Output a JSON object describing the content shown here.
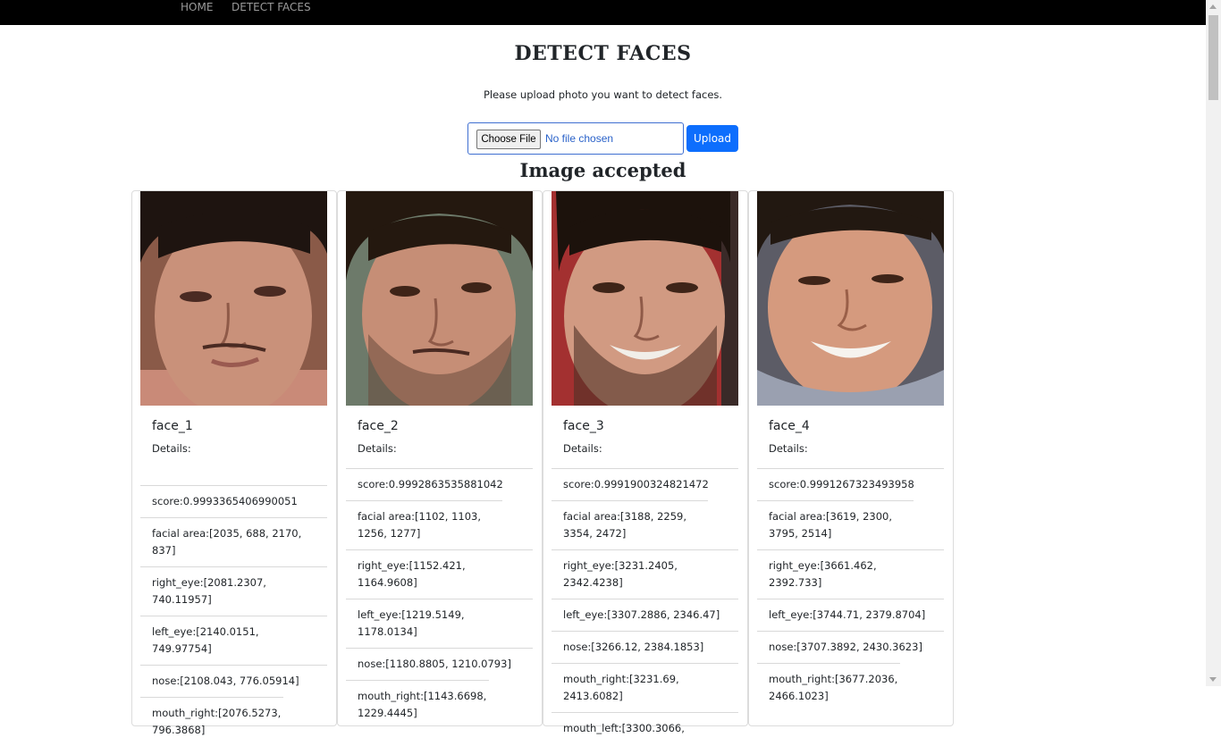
{
  "nav": {
    "items": [
      "HOME",
      "DETECT FACES"
    ]
  },
  "page": {
    "title": "DETECT FACES",
    "subtitle": "Please upload photo you want to detect faces.",
    "status": "Image accepted"
  },
  "upload": {
    "choose_label": "Choose File",
    "no_file_text": "No file chosen",
    "upload_label": "Upload"
  },
  "colors": {
    "navbar": "#000000",
    "primary": "#0d6efd",
    "link": "#2a62c9"
  },
  "faces": [
    {
      "name": "face_1",
      "details_label": "Details:",
      "items": [
        "score:0.9993365406990051",
        "facial area:[2035, 688, 2170, 837]",
        "right_eye:[2081.2307, 740.11957]",
        "left_eye:[2140.0151, 749.97754]",
        "nose:[2108.043, 776.05914]",
        "mouth_right:[2076.5273, 796.3868]"
      ]
    },
    {
      "name": "face_2",
      "details_label": "Details:",
      "items": [
        "score:0.9992863535881042",
        "facial area:[1102, 1103, 1256, 1277]",
        "right_eye:[1152.421, 1164.9608]",
        "left_eye:[1219.5149, 1178.0134]",
        "nose:[1180.8805, 1210.0793]",
        "mouth_right:[1143.6698, 1229.4445]"
      ]
    },
    {
      "name": "face_3",
      "details_label": "Details:",
      "items": [
        "score:0.9991900324821472",
        "facial area:[3188, 2259, 3354, 2472]",
        "right_eye:[3231.2405, 2342.4238]",
        "left_eye:[3307.2886, 2346.47]",
        "nose:[3266.12, 2384.1853]",
        "mouth_right:[3231.69, 2413.6082]",
        "mouth_left:[3300.3066,"
      ]
    },
    {
      "name": "face_4",
      "details_label": "Details:",
      "items": [
        "score:0.9991267323493958",
        "facial area:[3619, 2300, 3795, 2514]",
        "right_eye:[3661.462, 2392.733]",
        "left_eye:[3744.71, 2379.8704]",
        "nose:[3707.3892, 2430.3623]",
        "mouth_right:[3677.2036, 2466.1023]"
      ]
    }
  ]
}
